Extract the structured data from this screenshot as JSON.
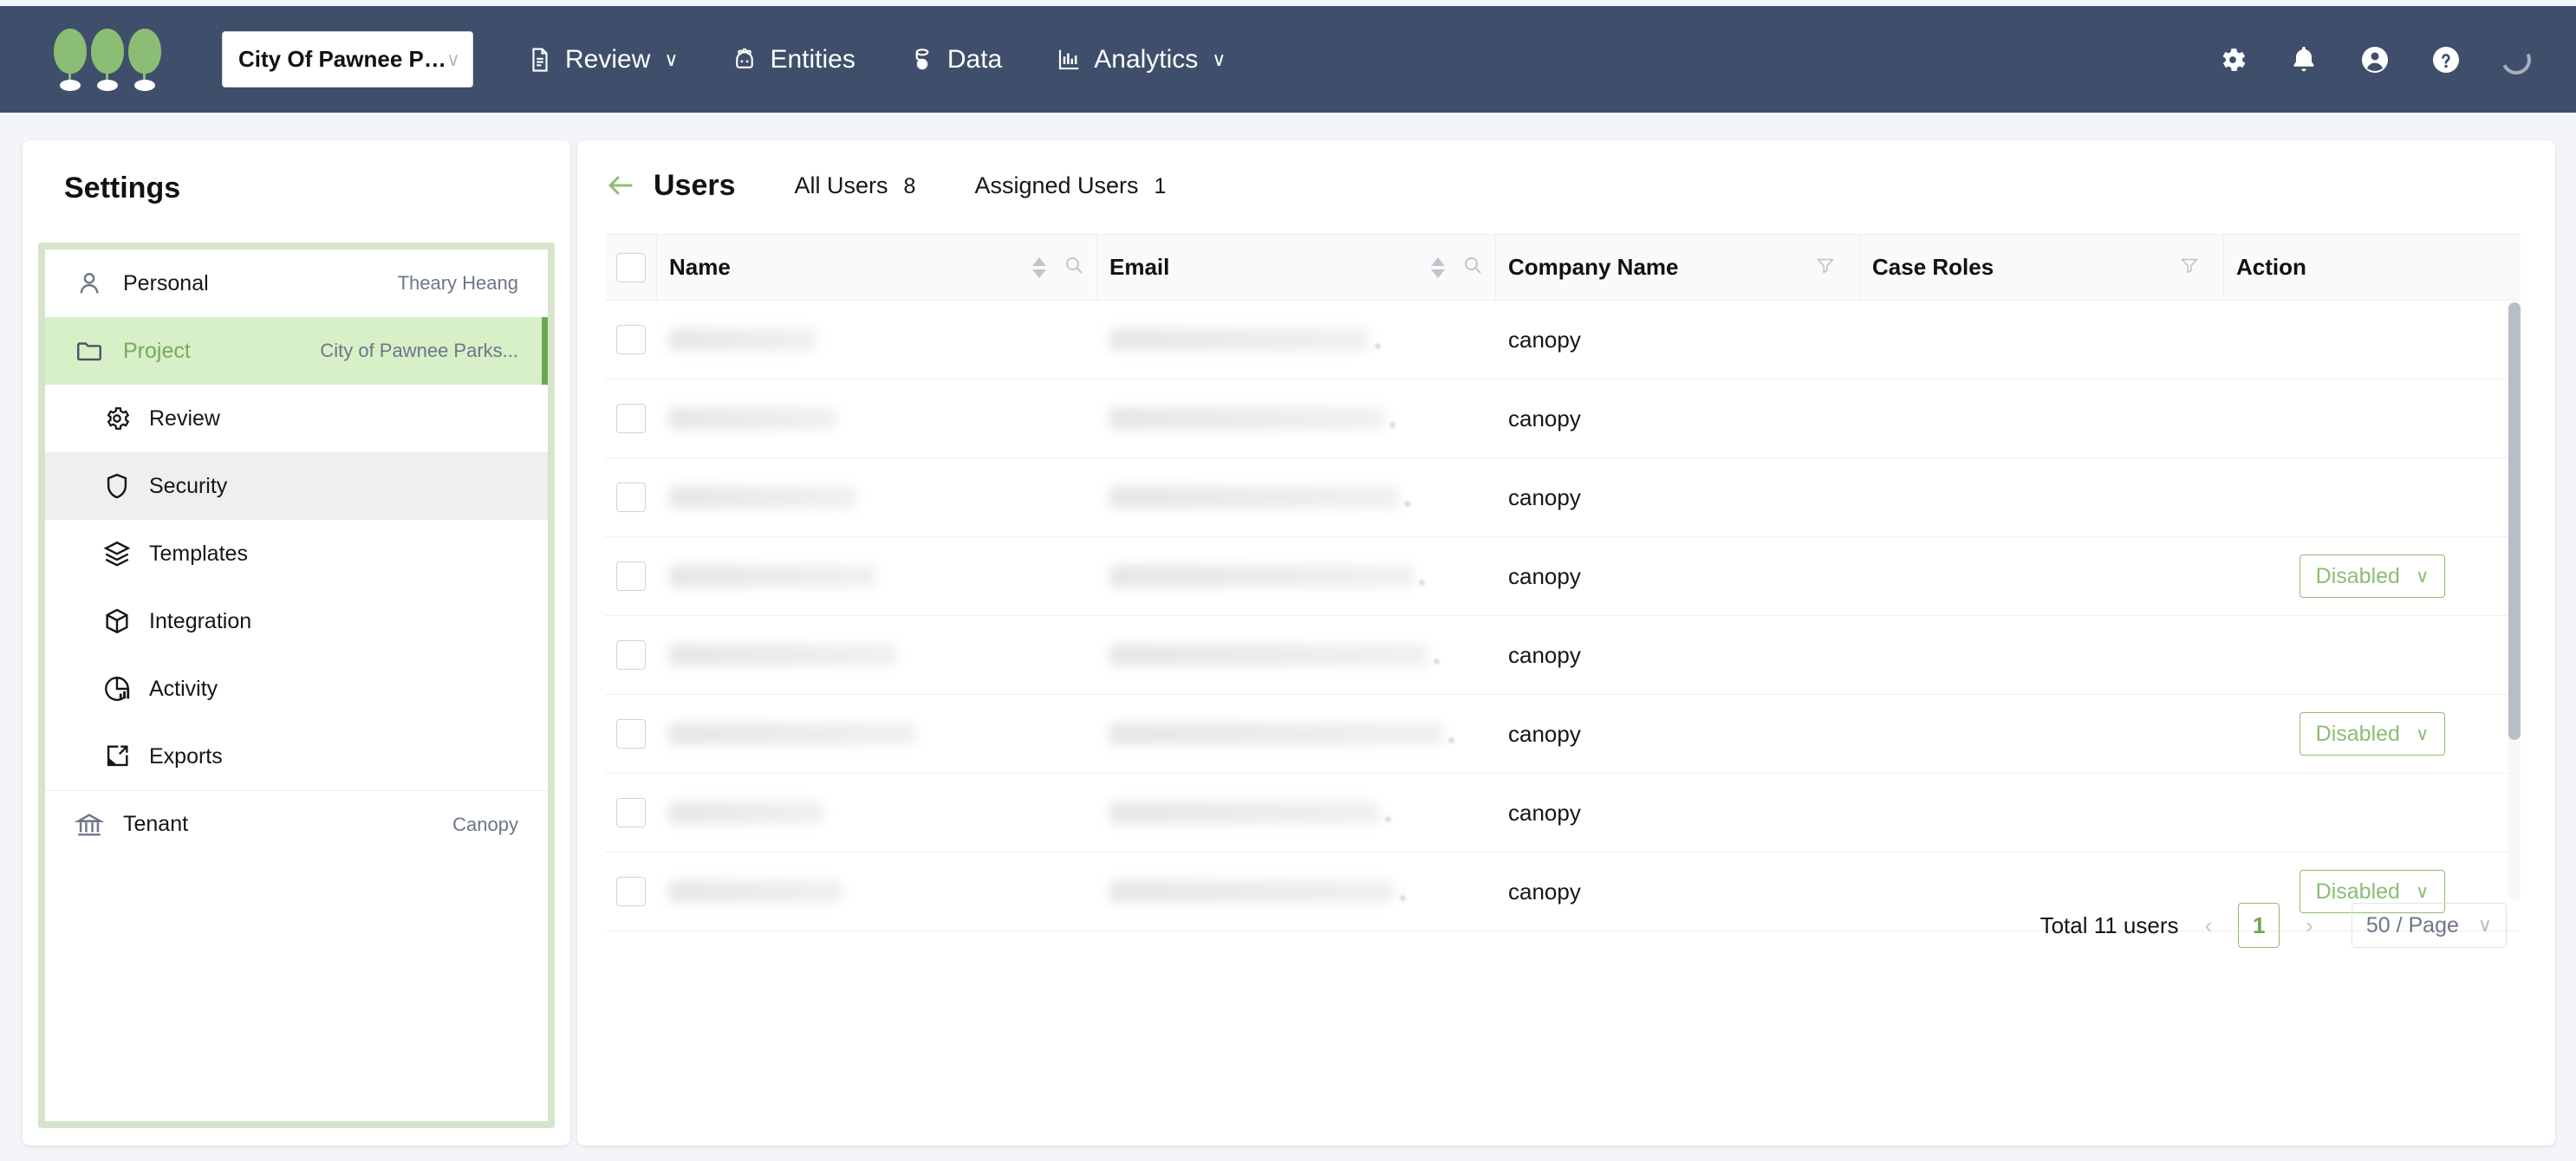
{
  "topbar": {
    "logo_name": "three-trees-logo",
    "project_selector": {
      "value": "City Of Pawnee Parks Dept",
      "chevron": "∨"
    },
    "nav": [
      {
        "label": "Review",
        "icon": "document-icon",
        "chevron": "∨"
      },
      {
        "label": "Entities",
        "icon": "entities-icon",
        "chevron": ""
      },
      {
        "label": "Data",
        "icon": "database-icon",
        "chevron": ""
      },
      {
        "label": "Analytics",
        "icon": "chart-icon",
        "chevron": "∨"
      }
    ],
    "actions": [
      {
        "name": "settings-gear-icon"
      },
      {
        "name": "notifications-bell-icon"
      },
      {
        "name": "account-avatar-icon"
      },
      {
        "name": "help-question-icon"
      },
      {
        "name": "loading-spinner-icon"
      }
    ]
  },
  "settings": {
    "title": "Settings",
    "items": [
      {
        "label": "Personal",
        "value": "Theary Heang",
        "icon": "person-icon",
        "state": "normal",
        "sub": false
      },
      {
        "label": "Project",
        "value": "City of Pawnee Parks...",
        "icon": "folder-icon",
        "state": "active-green",
        "sub": false
      },
      {
        "label": "Review",
        "value": "",
        "icon": "gear-icon",
        "state": "normal",
        "sub": true
      },
      {
        "label": "Security",
        "value": "",
        "icon": "shield-icon",
        "state": "active-grey",
        "sub": true
      },
      {
        "label": "Templates",
        "value": "",
        "icon": "layers-icon",
        "state": "normal",
        "sub": true
      },
      {
        "label": "Integration",
        "value": "",
        "icon": "package-icon",
        "state": "normal",
        "sub": true
      },
      {
        "label": "Activity",
        "value": "",
        "icon": "pie-chart-icon",
        "state": "normal",
        "sub": true
      },
      {
        "label": "Exports",
        "value": "",
        "icon": "export-icon",
        "state": "normal",
        "sub": true
      },
      {
        "label": "Tenant",
        "value": "Canopy",
        "icon": "bank-icon",
        "state": "divider",
        "sub": false
      }
    ]
  },
  "users": {
    "back_icon": "back-arrow-icon",
    "title": "Users",
    "tabs": [
      {
        "label": "All Users",
        "count": "8"
      },
      {
        "label": "Assigned Users",
        "count": "1"
      }
    ],
    "columns": [
      {
        "key": "check",
        "label": "",
        "sortable": false,
        "searchable": false,
        "filterable": false
      },
      {
        "key": "name",
        "label": "Name",
        "sortable": true,
        "searchable": true,
        "filterable": false
      },
      {
        "key": "email",
        "label": "Email",
        "sortable": true,
        "searchable": true,
        "filterable": false
      },
      {
        "key": "company",
        "label": "Company Name",
        "sortable": false,
        "searchable": false,
        "filterable": true
      },
      {
        "key": "roles",
        "label": "Case Roles",
        "sortable": false,
        "searchable": false,
        "filterable": true
      },
      {
        "key": "action",
        "label": "Action",
        "sortable": false,
        "searchable": false,
        "filterable": false
      }
    ],
    "rows": [
      {
        "name": "",
        "email": "",
        "company": "canopy",
        "roles": "",
        "action": ""
      },
      {
        "name": "",
        "email": "",
        "company": "canopy",
        "roles": "",
        "action": ""
      },
      {
        "name": "",
        "email": "",
        "company": "canopy",
        "roles": "",
        "action": ""
      },
      {
        "name": "",
        "email": "",
        "company": "canopy",
        "roles": "",
        "action": "Disabled"
      },
      {
        "name": "",
        "email": "",
        "company": "canopy",
        "roles": "",
        "action": ""
      },
      {
        "name": "",
        "email": "",
        "company": "canopy",
        "roles": "",
        "action": "Disabled"
      },
      {
        "name": "",
        "email": "",
        "company": "canopy",
        "roles": "",
        "action": ""
      },
      {
        "name": "",
        "email": "",
        "company": "canopy",
        "roles": "",
        "action": "Disabled"
      }
    ],
    "action_chevron": "∨",
    "pagination": {
      "total_label": "Total 11 users",
      "prev": "‹",
      "page": "1",
      "next": "›",
      "page_size": "50 / Page",
      "page_size_chevron": "∨"
    }
  },
  "colors": {
    "topbar_bg": "#3f4f6b",
    "accent_green": "#8cbd75",
    "active_green_bg": "#d7f0c8",
    "page_bg": "#f4f5f8"
  }
}
